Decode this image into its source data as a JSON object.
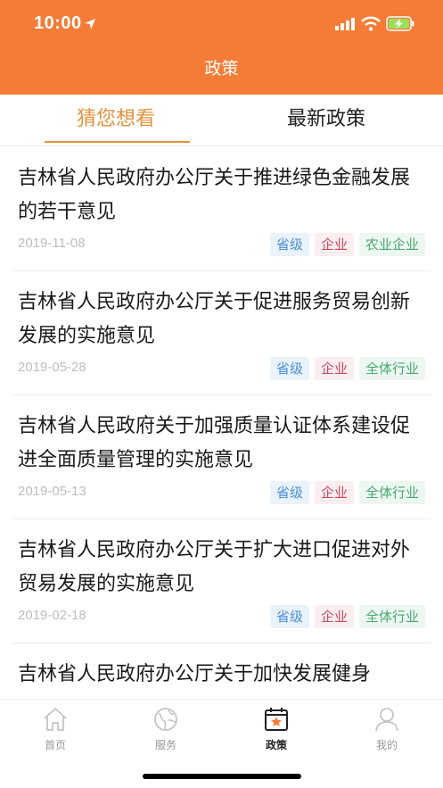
{
  "status_bar": {
    "time": "10:00"
  },
  "header": {
    "title": "政策"
  },
  "tabs": [
    {
      "label": "猜您想看",
      "active": true
    },
    {
      "label": "最新政策",
      "active": false
    }
  ],
  "items": [
    {
      "title": "吉林省人民政府办公厅关于推进绿色金融发展的若干意见",
      "date": "2019-11-08",
      "tags": [
        "省级",
        "企业",
        "农业企业"
      ]
    },
    {
      "title": "吉林省人民政府办公厅关于促进服务贸易创新发展的实施意见",
      "date": "2019-05-28",
      "tags": [
        "省级",
        "企业",
        "全体行业"
      ]
    },
    {
      "title": "吉林省人民政府关于加强质量认证体系建设促进全面质量管理的实施意见",
      "date": "2019-05-13",
      "tags": [
        "省级",
        "企业",
        "全体行业"
      ]
    },
    {
      "title": "吉林省人民政府办公厅关于扩大进口促进对外贸易发展的实施意见",
      "date": "2019-02-18",
      "tags": [
        "省级",
        "企业",
        "全体行业"
      ]
    },
    {
      "title": "吉林省人民政府办公厅关于加快发展健身",
      "date": "",
      "tags": []
    }
  ],
  "tabbar": {
    "items": [
      {
        "label": "首页",
        "icon": "home-icon",
        "active": false
      },
      {
        "label": "服务",
        "icon": "globe-icon",
        "active": false
      },
      {
        "label": "政策",
        "icon": "calendar-star-icon",
        "active": true
      },
      {
        "label": "我的",
        "icon": "user-icon",
        "active": false
      }
    ]
  },
  "colors": {
    "accent": "#f47c37",
    "tab_active": "#e4913c"
  }
}
